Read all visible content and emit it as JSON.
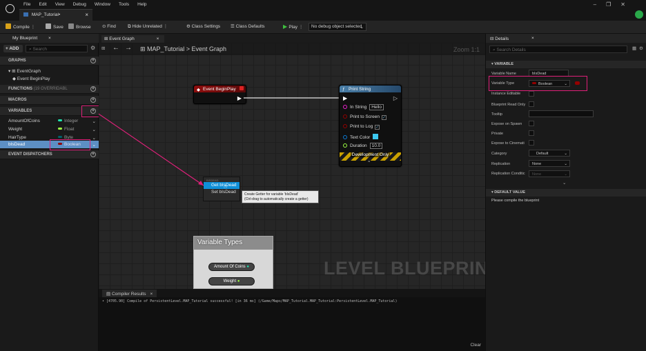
{
  "menu": [
    "File",
    "Edit",
    "View",
    "Debug",
    "Window",
    "Tools",
    "Help"
  ],
  "document_tab": "MAP_Tutorial•",
  "toolbar": {
    "compile": "Compile",
    "save": "Save",
    "browse": "Browse",
    "find": "Find",
    "hide_unrelated": "Hide Unrelated",
    "class_settings": "Class Settings",
    "class_defaults": "Class Defaults",
    "play": "Play",
    "debug_object": "No debug object selected"
  },
  "my_blueprint": {
    "tab": "My Blueprint",
    "add": "+ ADD",
    "search_placeholder": "Search",
    "graphs_header": "GRAPHS",
    "event_graph": "EventGraph",
    "event_begin_play": "Event BeginPlay",
    "functions_header": "FUNCTIONS",
    "functions_count": "(19 OVERRIDABL",
    "macros_header": "MACROS",
    "variables_header": "VARIABLES",
    "variables": [
      {
        "name": "AmountOfCoins",
        "type": "Integer",
        "color": "#1fe3af"
      },
      {
        "name": "Weight",
        "type": "Float",
        "color": "#9fff44"
      },
      {
        "name": "HairType",
        "type": "Byte",
        "color": "#00616b"
      },
      {
        "name": "bIsDead",
        "type": "Boolean",
        "color": "#950000"
      }
    ],
    "dispatchers_header": "EVENT DISPATCHERS"
  },
  "graph": {
    "tab": "Event Graph",
    "breadcrumb_root": "MAP_Tutorial",
    "breadcrumb_sep": ">",
    "breadcrumb_leaf": "Event Graph",
    "zoom": "Zoom 1:1",
    "watermark": "LEVEL BLUEPRINT",
    "begin_play_node": "Event BeginPlay",
    "print_node": {
      "title": "Print String",
      "in_string_label": "In String",
      "in_string_value": "Hello",
      "print_screen": "Print to Screen",
      "print_log": "Print to Log",
      "text_color": "Text Color",
      "duration": "Duration",
      "duration_value": "10.0",
      "dev_only": "Development Only"
    },
    "menu_header": "BISDEAD",
    "menu_get": "Get bIsDead",
    "menu_set": "Set bIsDead",
    "tooltip_line1": "Create Getter for variable 'bIsDead'",
    "tooltip_line2": "(Ctrl-drag to automatically create a getter)",
    "overlay_title": "Variable Types",
    "overlay_btn1": "Amount Of Coins",
    "overlay_btn2": "Weight"
  },
  "compiler": {
    "tab": "Compiler Results",
    "log": "• [4705.90] Compile of PersistentLevel.MAP_Tutorial successful! [in 36 ms] (/Game/Maps/MAP_Tutorial.MAP_Tutorial:PersistentLevel.MAP_Tutorial)",
    "clear": "Clear"
  },
  "details": {
    "tab": "Details",
    "search_placeholder": "Search Details",
    "variable_header": "VARIABLE",
    "variable_name_label": "Variable Name",
    "variable_name": "bIsDead",
    "variable_type_label": "Variable Type",
    "variable_type": "Boolean",
    "instance_editable": "Instance Editable",
    "blueprint_read_only": "Blueprint Read Only",
    "tooltip": "Tooltip",
    "expose_spawn": "Expose on Spawn",
    "private": "Private",
    "expose_cinematics": "Expose to Cinemati",
    "category": "Category",
    "category_value": "Default",
    "replication": "Replication",
    "replication_value": "None",
    "replication_cond": "Replication Conditic",
    "replication_cond_value": "None",
    "default_value_header": "DEFAULT VALUE",
    "default_value_msg": "Please compile the blueprint"
  }
}
